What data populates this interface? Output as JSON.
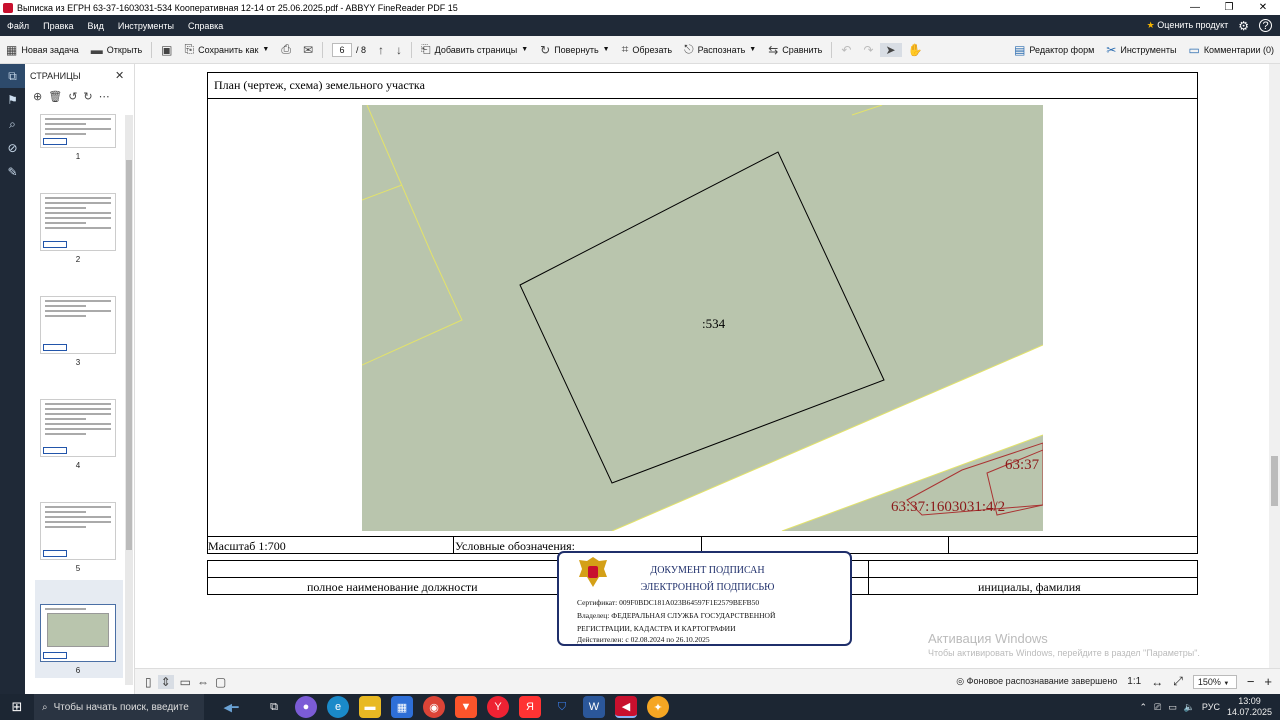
{
  "window": {
    "title": "Выписка из ЕГРН 63-37-1603031-534 Кооперативная 12-14 от 25.06.2025.pdf - ABBYY FineReader PDF 15"
  },
  "menu": {
    "items": [
      "Файл",
      "Правка",
      "Вид",
      "Инструменты",
      "Справка"
    ],
    "rate": "Оценить продукт"
  },
  "toolbar": {
    "new_task": "Новая задача",
    "open": "Открыть",
    "save_as": "Сохранить как",
    "page_current": "6",
    "page_total": "/ 8",
    "add_pages": "Добавить страницы",
    "rotate": "Повернуть",
    "crop": "Обрезать",
    "recognize": "Распознать",
    "compare": "Сравнить",
    "form_editor": "Редактор форм",
    "tools": "Инструменты",
    "comments": "Комментарии (0)"
  },
  "pages_panel": {
    "title": "СТРАНИЦЫ",
    "thumb_labels": [
      "1",
      "2",
      "3",
      "4",
      "5",
      "6"
    ],
    "selected": "6"
  },
  "document": {
    "plan_title": "План (чертеж, схема) земельного участка",
    "parcel_label": ":534",
    "neighbor_label_1": "63:37",
    "neighbor_label_2": "63:37:1603031:4/2",
    "scale": "Масштаб 1:700",
    "legend": "Условные обозначения:",
    "position_caption": "полное наименование должности",
    "name_caption": "инициалы, фамилия"
  },
  "stamp": {
    "line1": "ДОКУМЕНТ ПОДПИСАН",
    "line2": "ЭЛЕКТРОННОЙ ПОДПИСЬЮ",
    "cert": "Сертификат: 009F0BDC181A023B64597F1E2579BEFB50",
    "owner1": "Владелец: ФЕДЕРАЛЬНАЯ СЛУЖБА ГОСУДАРСТВЕННОЙ",
    "owner2": "РЕГИСТРАЦИИ, КАДАСТРА И КАРТОГРАФИИ",
    "valid": "Действителен: с 02.08.2024 по 26.10.2025"
  },
  "activation": {
    "title": "Активация Windows",
    "text": "Чтобы активировать Windows, перейдите в раздел \"Параметры\"."
  },
  "statusbar": {
    "bg_recognition": "Фоновое распознавание завершено",
    "ratio": "1:1",
    "zoom": "150%"
  },
  "taskbar": {
    "search_placeholder": "Чтобы начать поиск, введите",
    "lang": "РУС",
    "time": "13:09",
    "date": "14.07.2025"
  }
}
